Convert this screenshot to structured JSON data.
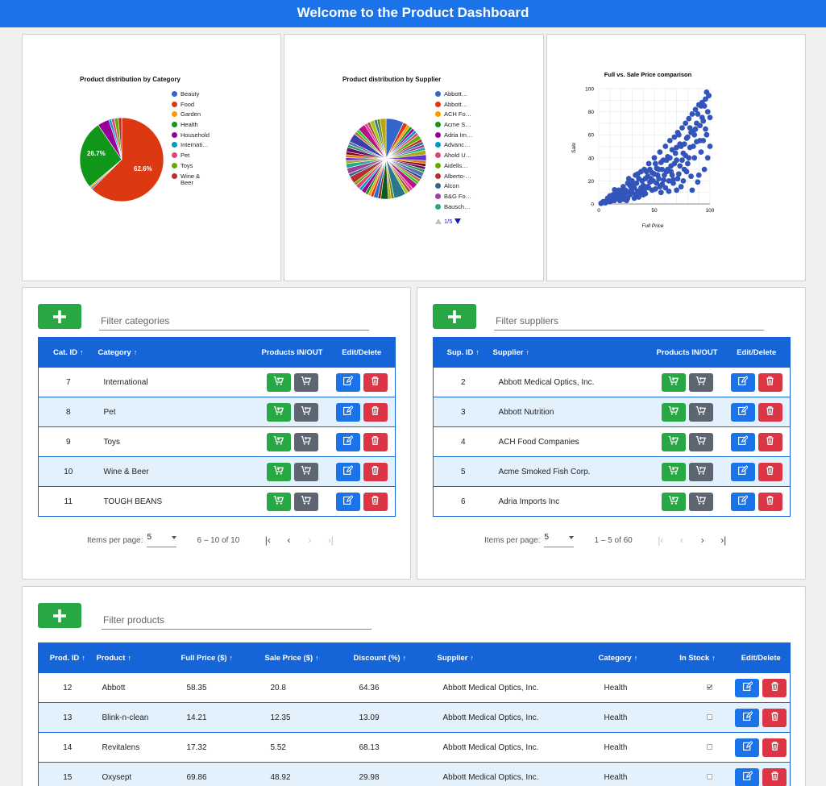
{
  "header": {
    "title": "Welcome to the Product Dashboard"
  },
  "category_chart": {
    "title": "Product distribution by Category",
    "legend": [
      {
        "label": "Beauty",
        "color": "#3366cc"
      },
      {
        "label": "Food",
        "color": "#dc3912"
      },
      {
        "label": "Garden",
        "color": "#ff9900"
      },
      {
        "label": "Health",
        "color": "#109618"
      },
      {
        "label": "Household",
        "color": "#990099"
      },
      {
        "label": "Internati…",
        "color": "#0099c6"
      },
      {
        "label": "Pet",
        "color": "#dd4477"
      },
      {
        "label": "Toys",
        "color": "#66aa00"
      },
      {
        "label": "Wine &",
        "color": "#b82e2e"
      },
      {
        "label": "Beer",
        "color": ""
      }
    ],
    "slice_labels": {
      "food": "62.6%",
      "health": "26.7%"
    }
  },
  "supplier_chart": {
    "title": "Product distribution by Supplier",
    "legend": [
      {
        "label": "Abbott…",
        "color": "#3366cc"
      },
      {
        "label": "Abbott…",
        "color": "#dc3912"
      },
      {
        "label": "ACH Fo…",
        "color": "#ff9900"
      },
      {
        "label": "Acme S…",
        "color": "#109618"
      },
      {
        "label": "Adria Im…",
        "color": "#990099"
      },
      {
        "label": "Advanc…",
        "color": "#0099c6"
      },
      {
        "label": "Ahold U…",
        "color": "#dd4477"
      },
      {
        "label": "Aidells…",
        "color": "#66aa00"
      },
      {
        "label": "Alberto-…",
        "color": "#b82e2e"
      },
      {
        "label": "Alcon",
        "color": "#316395"
      },
      {
        "label": "B&G Fo…",
        "color": "#994499"
      },
      {
        "label": "Bausch…",
        "color": "#22aa99"
      }
    ],
    "pager": "1/5"
  },
  "chart_data": [
    {
      "type": "pie",
      "title": "Product distribution by Category",
      "categories": [
        "Beauty",
        "Food",
        "Garden",
        "Health",
        "Household",
        "International",
        "Pet",
        "Toys",
        "Wine & Beer"
      ],
      "values": [
        0.6,
        62.6,
        0.6,
        26.7,
        4.5,
        1.0,
        1.2,
        1.5,
        1.3
      ],
      "colors": [
        "#3366cc",
        "#dc3912",
        "#ff9900",
        "#109618",
        "#990099",
        "#0099c6",
        "#dd4477",
        "#66aa00",
        "#b82e2e"
      ],
      "legend": "right"
    },
    {
      "type": "pie",
      "title": "Product distribution by Supplier",
      "categories": [
        "Abbott Medical Optics, Inc.",
        "Abbott Nutrition",
        "ACH Food Companies",
        "Acme Smoked Fish Corp.",
        "Adria Imports Inc",
        "Advanc…",
        "Ahold U…",
        "Aidells…",
        "Alberto-…",
        "Alcon",
        "B&G Fo…",
        "Bausch…"
      ],
      "legend": "right"
    },
    {
      "type": "scatter",
      "title": "Full vs. Sale Price comparison",
      "xlabel": "Full Price",
      "ylabel": "Sale",
      "xlim": [
        0,
        100
      ],
      "ylim": [
        0,
        100
      ],
      "xticks": [
        "0",
        "50",
        "100"
      ],
      "yticks": [
        "0",
        "20",
        "40",
        "60",
        "80",
        "100"
      ],
      "grid": true,
      "color": "#3355bb",
      "points": [
        [
          58.35,
          20.8
        ],
        [
          14.21,
          12.35
        ],
        [
          17.32,
          5.52
        ],
        [
          69.86,
          48.92
        ],
        [
          5,
          2
        ],
        [
          8,
          4
        ],
        [
          10,
          7
        ],
        [
          12,
          3
        ],
        [
          15,
          9
        ],
        [
          18,
          12
        ],
        [
          20,
          6
        ],
        [
          22,
          15
        ],
        [
          25,
          10
        ],
        [
          26,
          18
        ],
        [
          28,
          8
        ],
        [
          30,
          20
        ],
        [
          32,
          14
        ],
        [
          33,
          25
        ],
        [
          35,
          11
        ],
        [
          36,
          22
        ],
        [
          38,
          28
        ],
        [
          40,
          16
        ],
        [
          41,
          30
        ],
        [
          42,
          9
        ],
        [
          44,
          24
        ],
        [
          45,
          35
        ],
        [
          46,
          19
        ],
        [
          48,
          27
        ],
        [
          50,
          40
        ],
        [
          51,
          13
        ],
        [
          52,
          31
        ],
        [
          54,
          22
        ],
        [
          55,
          45
        ],
        [
          56,
          36
        ],
        [
          57,
          17
        ],
        [
          60,
          50
        ],
        [
          61,
          28
        ],
        [
          62,
          41
        ],
        [
          63,
          11
        ],
        [
          64,
          55
        ],
        [
          65,
          33
        ],
        [
          66,
          47
        ],
        [
          67,
          21
        ],
        [
          68,
          58
        ],
        [
          70,
          38
        ],
        [
          71,
          62
        ],
        [
          72,
          26
        ],
        [
          73,
          52
        ],
        [
          74,
          15
        ],
        [
          75,
          66
        ],
        [
          76,
          44
        ],
        [
          77,
          30
        ],
        [
          78,
          70
        ],
        [
          79,
          57
        ],
        [
          80,
          35
        ],
        [
          81,
          74
        ],
        [
          82,
          49
        ],
        [
          83,
          24
        ],
        [
          84,
          78
        ],
        [
          85,
          63
        ],
        [
          86,
          40
        ],
        [
          87,
          82
        ],
        [
          88,
          54
        ],
        [
          89,
          19
        ],
        [
          90,
          86
        ],
        [
          91,
          68
        ],
        [
          92,
          45
        ],
        [
          93,
          88
        ],
        [
          94,
          72
        ],
        [
          95,
          30
        ],
        [
          96,
          91
        ],
        [
          97,
          60
        ],
        [
          98,
          80
        ],
        [
          99,
          94
        ],
        [
          100,
          50
        ],
        [
          100,
          75
        ],
        [
          98,
          40
        ],
        [
          96,
          65
        ],
        [
          94,
          55
        ],
        [
          92,
          85
        ],
        [
          90,
          25
        ],
        [
          88,
          70
        ],
        [
          86,
          60
        ],
        [
          84,
          12
        ],
        [
          82,
          66
        ],
        [
          80,
          58
        ],
        [
          78,
          42
        ],
        [
          76,
          20
        ],
        [
          74,
          50
        ],
        [
          72,
          60
        ],
        [
          70,
          12
        ],
        [
          68,
          35
        ],
        [
          66,
          25
        ],
        [
          64,
          40
        ],
        [
          62,
          30
        ],
        [
          60,
          14
        ],
        [
          58,
          38
        ],
        [
          56,
          10
        ],
        [
          54,
          30
        ],
        [
          52,
          18
        ],
        [
          50,
          26
        ],
        [
          48,
          12
        ],
        [
          46,
          30
        ],
        [
          44,
          15
        ],
        [
          42,
          22
        ],
        [
          40,
          8
        ],
        [
          38,
          14
        ],
        [
          36,
          6
        ],
        [
          34,
          18
        ],
        [
          32,
          5
        ],
        [
          30,
          10
        ],
        [
          28,
          16
        ],
        [
          26,
          5
        ],
        [
          24,
          12
        ],
        [
          22,
          4
        ],
        [
          20,
          10
        ],
        [
          18,
          5
        ],
        [
          16,
          8
        ],
        [
          14,
          3
        ],
        [
          12,
          6
        ],
        [
          10,
          2
        ],
        [
          8,
          5
        ],
        [
          6,
          1
        ],
        [
          4,
          2
        ],
        [
          3,
          1
        ],
        [
          2,
          0.5
        ],
        [
          97,
          97
        ],
        [
          95,
          85
        ],
        [
          93,
          75
        ],
        [
          91,
          55
        ],
        [
          89,
          78
        ],
        [
          87,
          65
        ],
        [
          85,
          50
        ],
        [
          83,
          62
        ],
        [
          81,
          40
        ],
        [
          79,
          28
        ],
        [
          77,
          52
        ],
        [
          75,
          38
        ],
        [
          73,
          33
        ],
        [
          71,
          22
        ],
        [
          69,
          44
        ],
        [
          67,
          18
        ],
        [
          65,
          28
        ],
        [
          63,
          20
        ],
        [
          61,
          38
        ],
        [
          59,
          25
        ],
        [
          57,
          30
        ],
        [
          55,
          15
        ],
        [
          53,
          25
        ],
        [
          51,
          35
        ],
        [
          49,
          20
        ],
        [
          47,
          22
        ],
        [
          45,
          14
        ],
        [
          43,
          28
        ],
        [
          41,
          12
        ],
        [
          39,
          20
        ],
        [
          37,
          10
        ],
        [
          35,
          26
        ],
        [
          33,
          8
        ],
        [
          31,
          16
        ],
        [
          29,
          12
        ],
        [
          27,
          22
        ],
        [
          25,
          3
        ],
        [
          23,
          8
        ],
        [
          21,
          12
        ],
        [
          19,
          3
        ],
        [
          17,
          10
        ],
        [
          15,
          4
        ],
        [
          13,
          8
        ],
        [
          11,
          4
        ],
        [
          9,
          3
        ],
        [
          7,
          2
        ]
      ]
    }
  ],
  "categories_panel": {
    "filter_placeholder": "Filter categories",
    "columns": [
      "Cat. ID",
      "Category",
      "Products IN/OUT",
      "Edit/Delete"
    ],
    "rows": [
      {
        "id": "7",
        "name": "International"
      },
      {
        "id": "8",
        "name": "Pet"
      },
      {
        "id": "9",
        "name": "Toys"
      },
      {
        "id": "10",
        "name": "Wine & Beer"
      },
      {
        "id": "11",
        "name": "TOUGH BEANS"
      }
    ],
    "paginator": {
      "label": "Items per page:",
      "size": "5",
      "range": "6 – 10 of 10"
    }
  },
  "suppliers_panel": {
    "filter_placeholder": "Filter suppliers",
    "columns": [
      "Sup. ID",
      "Supplier",
      "Products IN/OUT",
      "Edit/Delete"
    ],
    "rows": [
      {
        "id": "2",
        "name": "Abbott Medical Optics, Inc."
      },
      {
        "id": "3",
        "name": "Abbott Nutrition"
      },
      {
        "id": "4",
        "name": "ACH Food Companies"
      },
      {
        "id": "5",
        "name": "Acme Smoked Fish Corp."
      },
      {
        "id": "6",
        "name": "Adria Imports Inc"
      }
    ],
    "paginator": {
      "label": "Items per page:",
      "size": "5",
      "range": "1 – 5 of 60"
    }
  },
  "products_panel": {
    "filter_placeholder": "Filter products",
    "columns": [
      "Prod. ID",
      "Product",
      "Full Price ($)",
      "Sale Price ($)",
      "Discount (%)",
      "Supplier",
      "Category",
      "In Stock",
      "Edit/Delete"
    ],
    "rows": [
      {
        "id": "12",
        "product": "Abbott",
        "full": "58.35",
        "sale": "20.8",
        "discount": "64.36",
        "supplier": "Abbott Medical Optics, Inc.",
        "category": "Health",
        "in_stock": true
      },
      {
        "id": "13",
        "product": "Blink-n-clean",
        "full": "14.21",
        "sale": "12.35",
        "discount": "13.09",
        "supplier": "Abbott Medical Optics, Inc.",
        "category": "Health",
        "in_stock": false
      },
      {
        "id": "14",
        "product": "Revitalens",
        "full": "17.32",
        "sale": "5.52",
        "discount": "68.13",
        "supplier": "Abbott Medical Optics, Inc.",
        "category": "Health",
        "in_stock": false
      },
      {
        "id": "15",
        "product": "Oxysept",
        "full": "69.86",
        "sale": "48.92",
        "discount": "29.98",
        "supplier": "Abbott Medical Optics, Inc.",
        "category": "Health",
        "in_stock": false
      }
    ]
  },
  "icons": {
    "add": "plus-icon",
    "in": "cart-in-icon",
    "out": "cart-out-icon",
    "edit": "edit-icon",
    "delete": "trash-icon",
    "sort": "arrow-up-icon"
  },
  "colors": {
    "header": "#1a73e8",
    "table_header": "#1565d8",
    "alt_row": "#e3f1fd",
    "add": "#28a745",
    "in": "#28a745",
    "out": "#5c6570",
    "edit": "#1a73e8",
    "delete": "#dc3545"
  }
}
